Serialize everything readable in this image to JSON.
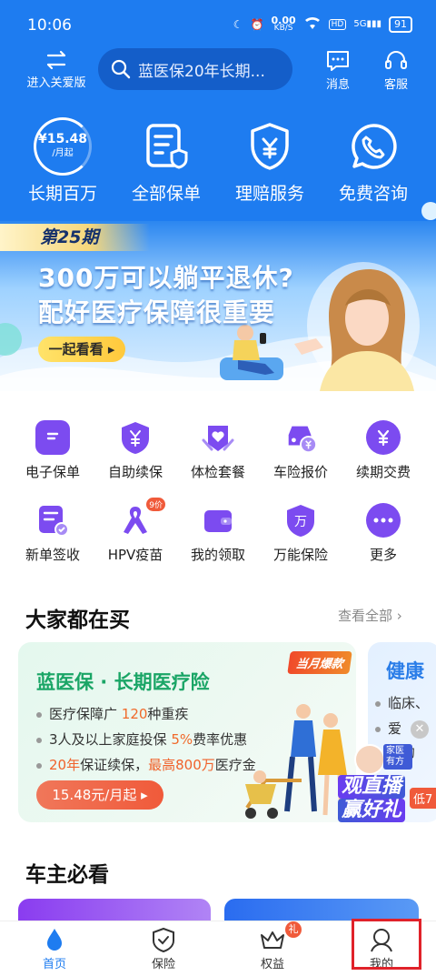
{
  "status": {
    "time": "10:06",
    "speed": "0.00",
    "speed_unit": "KB/S",
    "battery": "91",
    "net": "5G"
  },
  "header": {
    "care_label": "进入关爱版",
    "search_placeholder": "蓝医保20年长期...",
    "message_label": "消息",
    "service_label": "客服"
  },
  "quick": {
    "items": [
      {
        "label": "长期百万",
        "badge_value": "¥15.48",
        "badge_unit": "/月起"
      },
      {
        "label": "全部保单"
      },
      {
        "label": "理赔服务"
      },
      {
        "label": "免费咨询"
      }
    ]
  },
  "banner": {
    "period": "第25期",
    "line1": "300万可以躺平退休?",
    "line2": "配好医疗保障很重要",
    "cta": "一起看看"
  },
  "services": {
    "items": [
      {
        "label": "电子保单",
        "icon": "document-icon"
      },
      {
        "label": "自助续保",
        "icon": "yuan-shield-icon"
      },
      {
        "label": "体检套餐",
        "icon": "health-check-icon"
      },
      {
        "label": "车险报价",
        "icon": "car-icon"
      },
      {
        "label": "续期交费",
        "icon": "yuan-circle-icon"
      },
      {
        "label": "新单签收",
        "icon": "sign-icon"
      },
      {
        "label": "HPV疫苗",
        "icon": "ribbon-icon",
        "badge": "9价"
      },
      {
        "label": "我的领取",
        "icon": "wallet-icon"
      },
      {
        "label": "万能保险",
        "icon": "wan-shield-icon"
      },
      {
        "label": "更多",
        "icon": "more-icon"
      }
    ]
  },
  "popular": {
    "title": "大家都在买",
    "view_all": "查看全部"
  },
  "card1": {
    "title": "蓝医保 · 长期医疗险",
    "tag": "当月爆款",
    "b1_pre": "医疗保障广 ",
    "b1_hl": "120",
    "b1_post": "种重疾",
    "b2_pre": "3人及以上家庭投保 ",
    "b2_hl": "5%",
    "b2_post": "费率优惠",
    "b3_hl1": "20年",
    "b3_mid": "保证续保，",
    "b3_hl2": "最高800万",
    "b3_post": "医疗金",
    "price": "15.48元/月起"
  },
  "card2": {
    "title": "健康",
    "b1": "临床、",
    "b2": "爱",
    "b3": "国约",
    "live1": "观直播",
    "live2": "赢好礼",
    "host": "家医有方",
    "low": "低7"
  },
  "owners": {
    "title": "车主必看"
  },
  "tabbar": {
    "items": [
      {
        "label": "首页",
        "active": true
      },
      {
        "label": "保险"
      },
      {
        "label": "权益",
        "badge": "礼"
      },
      {
        "label": "我的"
      }
    ]
  },
  "colors": {
    "brand_blue": "#1e7cf0",
    "accent_orange": "#f06a2b",
    "highlight_red": "#e0222a",
    "icon_purple": "#7c4bf0"
  }
}
